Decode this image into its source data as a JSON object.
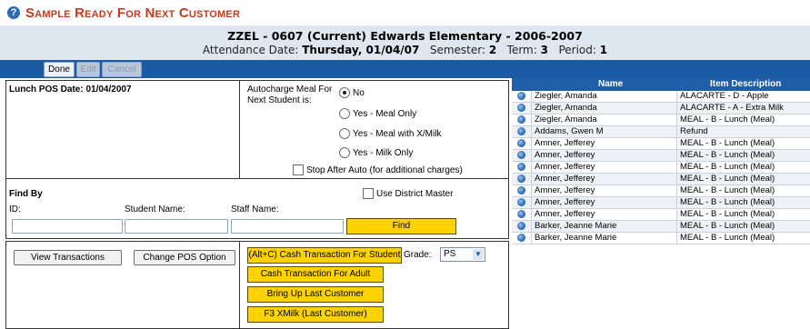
{
  "page": {
    "title": "Sample Ready For Next Customer",
    "school_line": "ZZEL - 0607 (Current) Edwards Elementary - 2006-2007",
    "attendance": {
      "date_label": "Attendance Date:",
      "date_value": "Thursday, 01/04/07",
      "semester_label": "Semester:",
      "semester_value": "2",
      "term_label": "Term:",
      "term_value": "3",
      "period_label": "Period:",
      "period_value": "1"
    }
  },
  "toolbar": {
    "done": "Done",
    "edit": "Edit",
    "cancel": "Cancel"
  },
  "pos": {
    "date_label": "Lunch POS Date: 01/04/2007",
    "autocharge_label_1": "Autocharge Meal For",
    "autocharge_label_2": "Next Student is:",
    "options": [
      "No",
      "Yes - Meal Only",
      "Yes - Meal with X/Milk",
      "Yes - Milk Only"
    ],
    "selected_option": "No",
    "stop_after_auto": "Stop After Auto (for additional charges)"
  },
  "find": {
    "title": "Find By",
    "use_district_master": "Use District Master",
    "id_label": "ID:",
    "student_label": "Student Name:",
    "staff_label": "Staff Name:",
    "id_value": "",
    "student_value": "",
    "staff_value": "",
    "find_button": "Find"
  },
  "actions": {
    "view_transactions": "View Transactions",
    "change_pos_option": "Change POS Option",
    "cash_student": "(Alt+C) Cash Transaction For Student",
    "grade_label": "Grade:",
    "grade_value": "PS",
    "cash_adult": "Cash Transaction For Adult",
    "bring_up_last": "Bring Up Last Customer",
    "f3_xmilk": "F3 XMilk (Last Customer)"
  },
  "transactions": {
    "columns": [
      "Name",
      "Item Description"
    ],
    "rows": [
      {
        "name": "Ziegler, Amanda",
        "item": "ALACARTE - D - Apple"
      },
      {
        "name": "Ziegler, Amanda",
        "item": "ALACARTE - A - Extra Milk"
      },
      {
        "name": "Ziegler, Amanda",
        "item": "MEAL - B - Lunch (Meal)"
      },
      {
        "name": "Addams, Gwen M",
        "item": "Refund"
      },
      {
        "name": "Amner, Jefferey",
        "item": "MEAL - B - Lunch (Meal)"
      },
      {
        "name": "Amner, Jefferey",
        "item": "MEAL - B - Lunch (Meal)"
      },
      {
        "name": "Amner, Jefferey",
        "item": "MEAL - B - Lunch (Meal)"
      },
      {
        "name": "Amner, Jefferey",
        "item": "MEAL - B - Lunch (Meal)"
      },
      {
        "name": "Amner, Jefferey",
        "item": "MEAL - B - Lunch (Meal)"
      },
      {
        "name": "Amner, Jefferey",
        "item": "MEAL - B - Lunch (Meal)"
      },
      {
        "name": "Amner, Jefferey",
        "item": "MEAL - B - Lunch (Meal)"
      },
      {
        "name": "Barker, Jeanne Marie",
        "item": "MEAL - B - Lunch (Meal)"
      },
      {
        "name": "Barker, Jeanne Marie",
        "item": "MEAL - B - Lunch (Meal)"
      }
    ]
  },
  "colors": {
    "title": "#c43a1c",
    "header_band": "#dfe7f1",
    "toolbar": "#1c5aa3",
    "grid_header": "#1f5ea8",
    "action_button": "#fcd200"
  }
}
